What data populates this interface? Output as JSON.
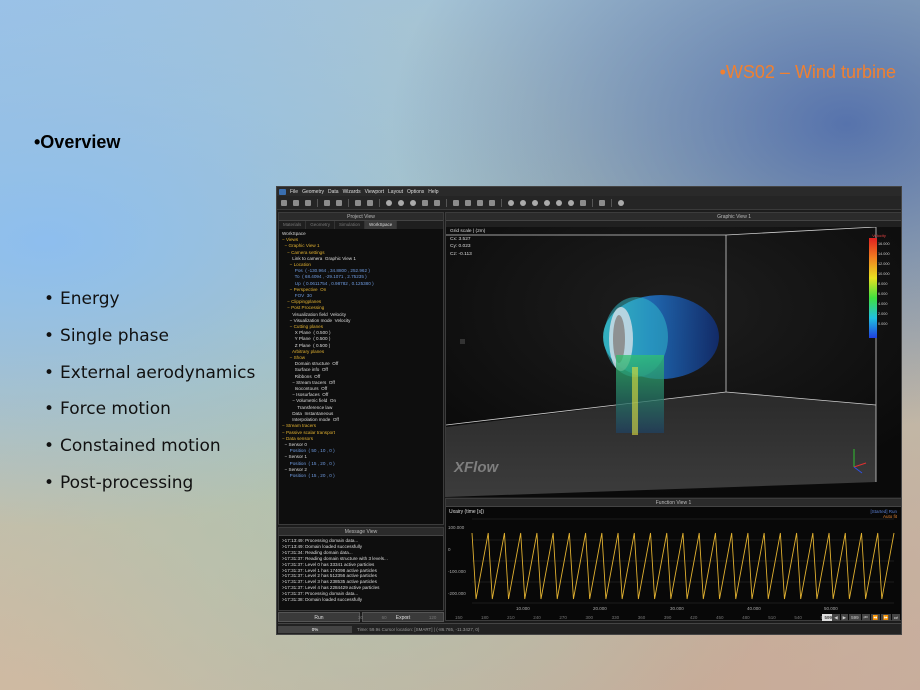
{
  "slide": {
    "title": "•WS02 – Wind turbine",
    "overview": "•Overview",
    "bullets": [
      "Energy",
      "Single phase",
      "External aerodynamics",
      "Force motion",
      "Constained motion",
      "Post-processing"
    ]
  },
  "app": {
    "menu": [
      "File",
      "Geometry",
      "Data",
      "Wizards",
      "Viewport",
      "Layout",
      "Options",
      "Help"
    ],
    "project_view": {
      "title": "Project View",
      "tabs": [
        "Materials",
        "Geometry",
        "Simulation",
        "WorkSpace"
      ],
      "tree": [
        {
          "t": "WorkSpace",
          "c": "w"
        },
        {
          "t": "− Views",
          "c": "y"
        },
        {
          "t": "  − Graphic View 1",
          "c": "y"
        },
        {
          "t": "    − Camera settings",
          "c": "y"
        },
        {
          "t": "        Link to camera  Graphic View 1",
          "c": "w"
        },
        {
          "t": "      − Location",
          "c": "y"
        },
        {
          "t": "          Pos  ( -130.964 , 34.8800 , 252.962 )",
          "c": "b"
        },
        {
          "t": "          To  ( 68.4094 , -29.1071 , 2.75235 )",
          "c": "b"
        },
        {
          "t": "          Up  ( 0.0611754 , 0.98782 , 0.125380 )",
          "c": "b"
        },
        {
          "t": "      − Perspective  On",
          "c": "y"
        },
        {
          "t": "          FOV  30",
          "c": "b"
        },
        {
          "t": "    − Clippingplanes",
          "c": "y"
        },
        {
          "t": "    − Post Processing",
          "c": "y"
        },
        {
          "t": "        Visualization field  Velocity",
          "c": "w"
        },
        {
          "t": "      − Visualization mode  Velocity",
          "c": "w"
        },
        {
          "t": "      − Cutting planes",
          "c": "y"
        },
        {
          "t": "          X Plane  ( 0.500 )",
          "c": "w"
        },
        {
          "t": "          Y Plane  ( 0.500 )",
          "c": "w"
        },
        {
          "t": "          Z Plane  ( 0.500 )",
          "c": "w"
        },
        {
          "t": "        Arbitrary planes",
          "c": "y"
        },
        {
          "t": "      − Show",
          "c": "y"
        },
        {
          "t": "          Domain structure  Off",
          "c": "w"
        },
        {
          "t": "          Surface info  Off",
          "c": "w"
        },
        {
          "t": "          Ribbons  Off",
          "c": "w"
        },
        {
          "t": "        − Stream tracers  Off",
          "c": "w"
        },
        {
          "t": "          Isocontours  Off",
          "c": "w"
        },
        {
          "t": "        − Isosurfaces  Off",
          "c": "w"
        },
        {
          "t": "        − Volumetric field  On",
          "c": "w"
        },
        {
          "t": "            Transference law",
          "c": "w"
        },
        {
          "t": "        Data  Instantaneous",
          "c": "w"
        },
        {
          "t": "        Interpolation mode  Off",
          "c": "w"
        },
        {
          "t": "− Stream tracers",
          "c": "y"
        },
        {
          "t": "− Passive scalar transport",
          "c": "y"
        },
        {
          "t": "− Data sensors",
          "c": "y"
        },
        {
          "t": "  − Sensor 0",
          "c": "w"
        },
        {
          "t": "      Position  ( 50 , 10 , 0 )",
          "c": "b"
        },
        {
          "t": "  − Sensor 1",
          "c": "w"
        },
        {
          "t": "      Position  ( 15 , 20 , 0 )",
          "c": "b"
        },
        {
          "t": "  − Sensor 2",
          "c": "w"
        },
        {
          "t": "      Position  ( 15 , 20 , 0 )",
          "c": "b"
        }
      ]
    },
    "graphic_view": {
      "title": "Graphic View 1",
      "info": [
        "Grid scale      |  (2m)",
        "Cx: 3.527",
        "Cy: 0.023",
        "Cz: -0.113"
      ],
      "brand": "XFlow",
      "legend_title": "Velocity",
      "legend_ticks": [
        "16.000",
        "14.000",
        "12.000",
        "10.000",
        "8.000",
        "6.000",
        "4.000",
        "2.000",
        "0.000"
      ]
    },
    "function_view": {
      "title": "Function View 1",
      "y_label": "Uxairy (time [s])",
      "right_top": "[Started] Run",
      "right_sub": "Auto fit",
      "chart_data": {
        "type": "line",
        "series": [
          {
            "name": "",
            "shape": "sawtooth",
            "cycles": 26,
            "color": "#e0b030"
          }
        ],
        "y_ticks": [
          "100.000",
          "0",
          "-100.000",
          "-200.000"
        ],
        "x_ticks": [
          "10.000",
          "20.000",
          "30.000",
          "40.000",
          "50.000"
        ]
      }
    },
    "message_view": {
      "title": "Message View",
      "lines": [
        ">17:13:49: Processing domain data...",
        ">17:13:49: Domain loaded successfully",
        ">17:31:34: Reading domain data...",
        ">17:31:37: Reading domain structure with 3 levels...",
        ">17:31:37:  Level 0 has 33341 active particles",
        ">17:31:37:  Level 1 has 174098 active particles",
        ">17:31:37:  Level 2 has 512356 active particles",
        ">17:31:37:  Level 3 has 238535 active particles",
        ">17:31:37:  Level 4 has 2284429 active particles",
        ">17:31:37: Processing domain data...",
        ">17:31:38: Domain loaded successfully"
      ]
    },
    "run": {
      "run_label": "Run",
      "export_label": "Export",
      "progress_label": "0%"
    },
    "timeline": {
      "ticks": [
        "30",
        "60",
        "90",
        "120",
        "150",
        "180",
        "210",
        "240",
        "270",
        "300",
        "330",
        "360",
        "390",
        "420",
        "450",
        "480",
        "510",
        "540",
        "570"
      ],
      "status": "Time: 59.9s   Cursor location: [SMART] | (-86.765, -11.3427, 0)",
      "frame": "599",
      "controls": [
        "◀",
        "▶",
        "599",
        "⏮",
        "⏪",
        "⏩",
        "⏭"
      ]
    }
  }
}
